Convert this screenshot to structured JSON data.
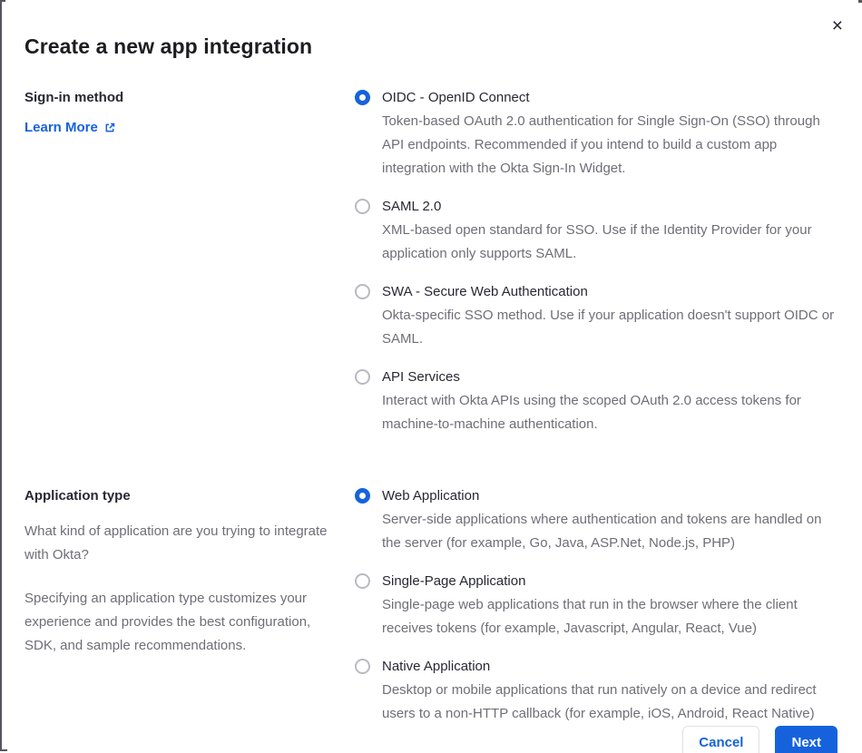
{
  "colors": {
    "primary": "#1662dd",
    "title_text": "#1d1d21",
    "label_text": "#272833",
    "body_text": "#6e6e78",
    "radio_unchecked_border": "#b9b9c2",
    "divider": "#e1e1e6",
    "cancel_border": "#e1e1e6",
    "frame_border": "#55555c"
  },
  "dialog": {
    "title": "Create a new app integration",
    "close_icon": "×"
  },
  "signin_section": {
    "label": "Sign-in method",
    "learn_more_label": "Learn More",
    "options": [
      {
        "label": "OIDC - OpenID Connect",
        "description": "Token-based OAuth 2.0 authentication for Single Sign-On (SSO) through API endpoints. Recommended if you intend to build a custom app integration with the Okta Sign-In Widget.",
        "selected": true
      },
      {
        "label": "SAML 2.0",
        "description": "XML-based open standard for SSO. Use if the Identity Provider for your application only supports SAML.",
        "selected": false
      },
      {
        "label": "SWA - Secure Web Authentication",
        "description": "Okta-specific SSO method. Use if your application doesn't support OIDC or SAML.",
        "selected": false
      },
      {
        "label": "API Services",
        "description": "Interact with Okta APIs using the scoped OAuth 2.0 access tokens for machine-to-machine authentication.",
        "selected": false
      }
    ]
  },
  "apptype_section": {
    "label": "Application type",
    "description_1": "What kind of application are you trying to integrate with Okta?",
    "description_2": "Specifying an application type customizes your experience and provides the best configuration, SDK, and sample recommendations.",
    "options": [
      {
        "label": "Web Application",
        "description": "Server-side applications where authentication and tokens are handled on the server (for example, Go, Java, ASP.Net, Node.js, PHP)",
        "selected": true
      },
      {
        "label": "Single-Page Application",
        "description": "Single-page web applications that run in the browser where the client receives tokens (for example, Javascript, Angular, React, Vue)",
        "selected": false
      },
      {
        "label": "Native Application",
        "description": "Desktop or mobile applications that run natively on a device and redirect users to a non-HTTP callback (for example, iOS, Android, React Native)",
        "selected": false
      }
    ]
  },
  "footer": {
    "cancel_label": "Cancel",
    "next_label": "Next"
  }
}
